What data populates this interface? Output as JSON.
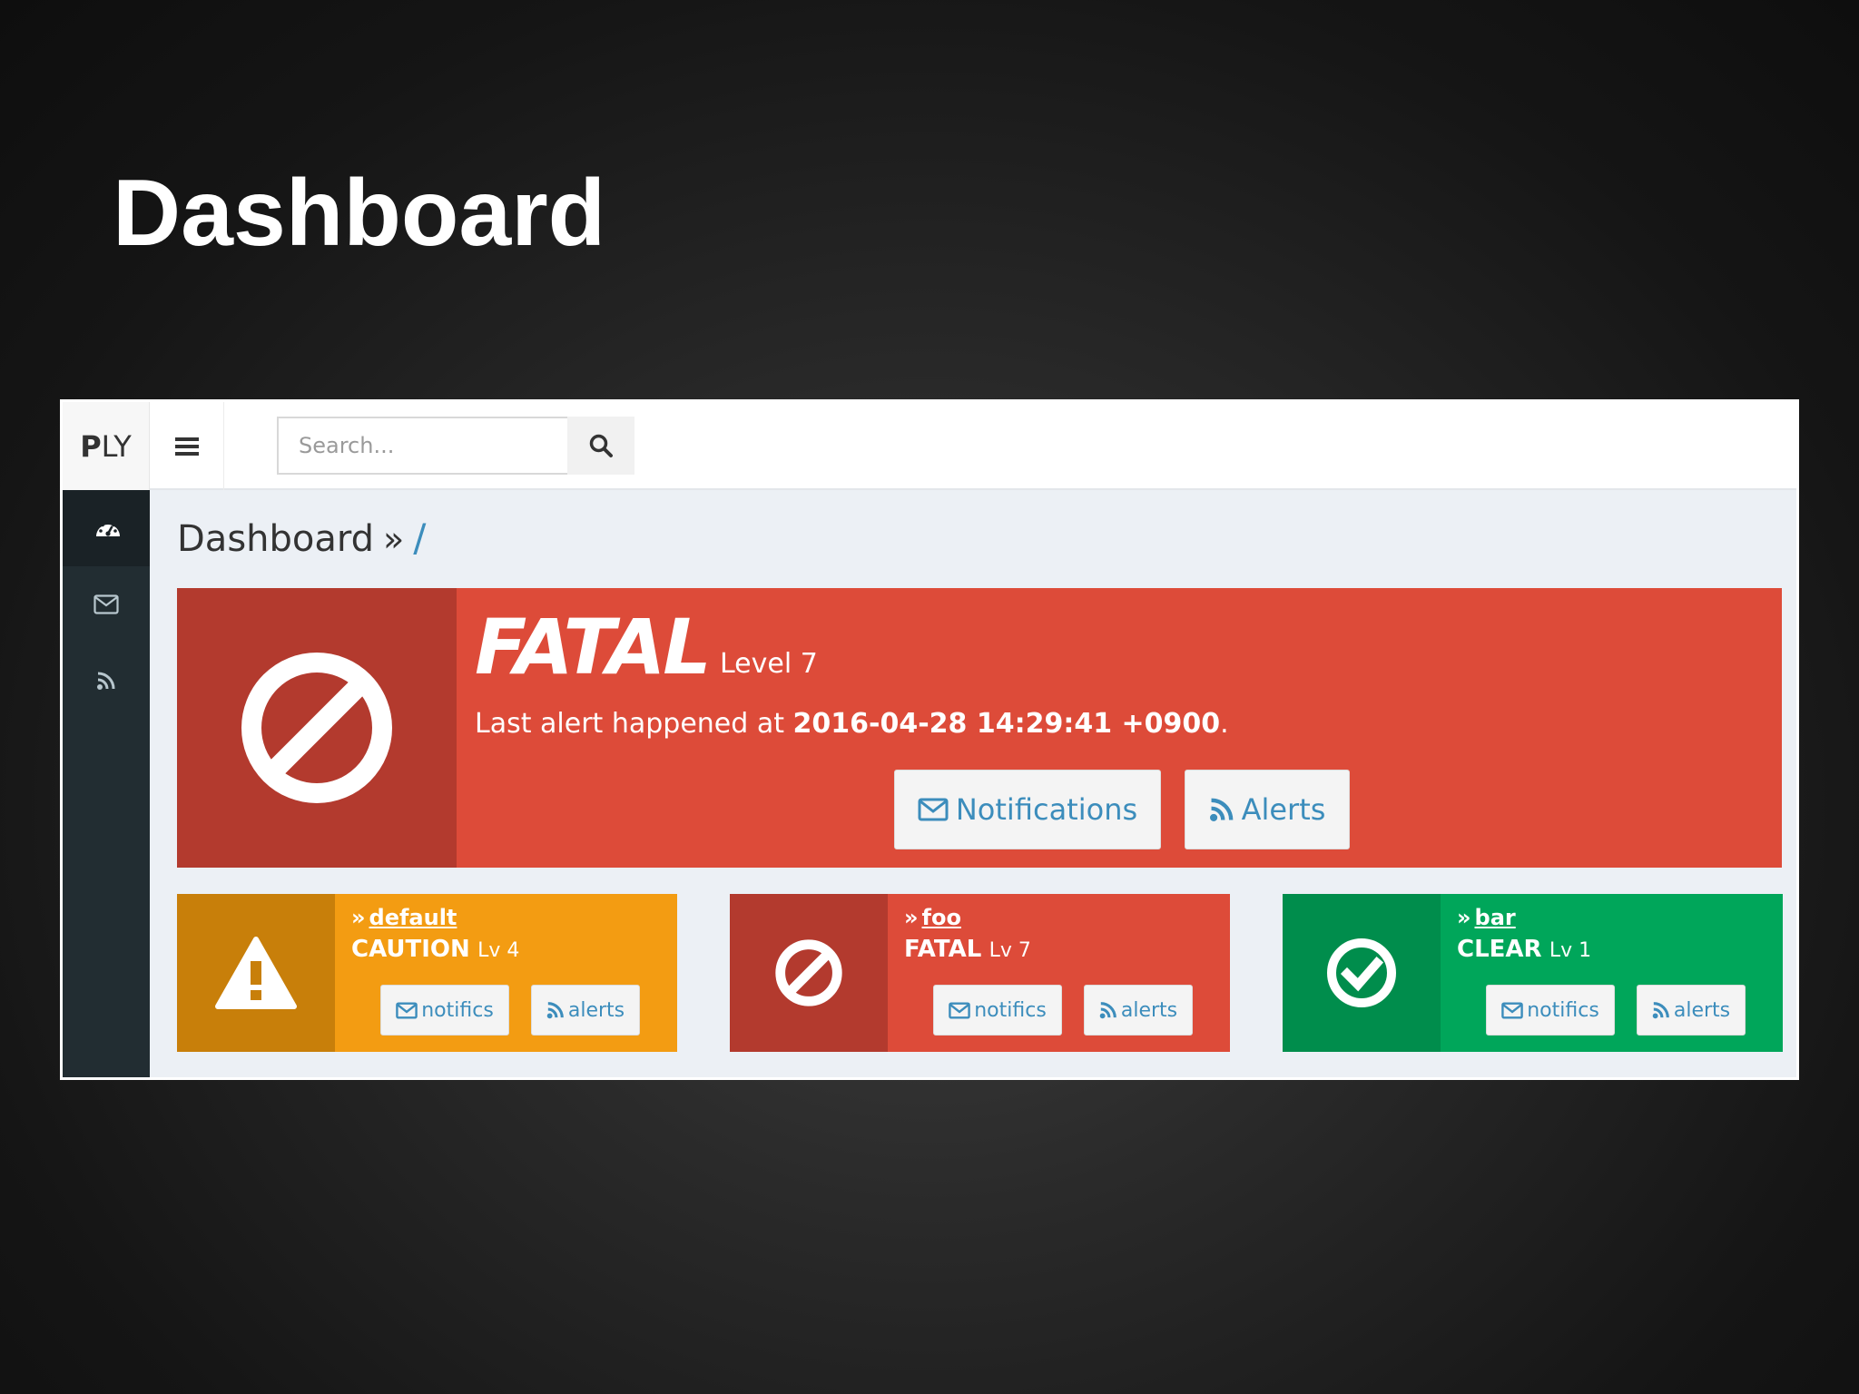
{
  "slide": {
    "title": "Dashboard"
  },
  "app": {
    "logo_bold": "P",
    "logo_rest": "LY",
    "search_placeholder": "Search..."
  },
  "breadcrumb": {
    "title": "Dashboard",
    "separator": "»",
    "path": "/"
  },
  "overview": {
    "status": "FATAL",
    "level": "Level 7",
    "message_prefix": "Last alert happened at ",
    "timestamp": "2016-04-28 14:29:41 +0900",
    "message_suffix": ".",
    "notifications_label": "Notifications",
    "alerts_label": "Alerts",
    "color": "#dd4b39"
  },
  "items": [
    {
      "name": "default",
      "status": "CAUTION",
      "level": "Lv 4",
      "icon": "warning-icon",
      "color": "#f39c12",
      "notifics_label": "notifics",
      "alerts_label": "alerts"
    },
    {
      "name": "foo",
      "status": "FATAL",
      "level": "Lv 7",
      "icon": "ban-icon",
      "color": "#dd4b39",
      "notifics_label": "notifics",
      "alerts_label": "alerts"
    },
    {
      "name": "bar",
      "status": "CLEAR",
      "level": "Lv 1",
      "icon": "check-circle-icon",
      "color": "#00a65a",
      "notifics_label": "notifics",
      "alerts_label": "alerts"
    }
  ],
  "sidebar": {
    "items": [
      {
        "icon": "dashboard-icon"
      },
      {
        "icon": "envelope-icon"
      },
      {
        "icon": "rss-icon"
      }
    ]
  }
}
